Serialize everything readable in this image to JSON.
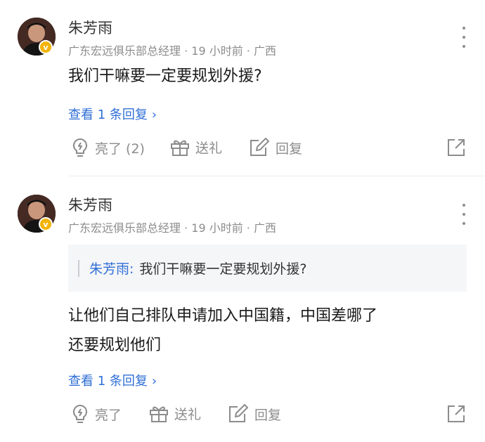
{
  "comments": [
    {
      "user": "朱芳雨",
      "verified_badge": "v",
      "meta": "广东宏远俱乐部总经理 · 19 小时前 · 广西",
      "text": "我们干嘛要一定要规划外援?",
      "view_replies": "查看 1 条回复",
      "actions": {
        "like": "亮了 (2)",
        "gift": "送礼",
        "reply": "回复"
      }
    },
    {
      "user": "朱芳雨",
      "verified_badge": "v",
      "meta": "广东宏远俱乐部总经理 · 19 小时前 · 广西",
      "quote_name": "朱芳雨:",
      "quote_text": "我们干嘛要一定要规划外援?",
      "text_line1": "让他们自己排队申请加入中国籍，中国差哪了",
      "text_line2": "还要规划他们",
      "view_replies": "查看 1 条回复",
      "actions": {
        "like": "亮了",
        "gift": "送礼",
        "reply": "回复"
      }
    }
  ],
  "icons": [
    "more-icon",
    "bulb-icon",
    "gift-icon",
    "edit-icon",
    "share-icon",
    "chevron-right-icon"
  ],
  "colors": {
    "link": "#2f6fd6",
    "meta": "#8c8c8c",
    "badge": "#f2b40a",
    "quote_bg": "#f5f6f8"
  }
}
